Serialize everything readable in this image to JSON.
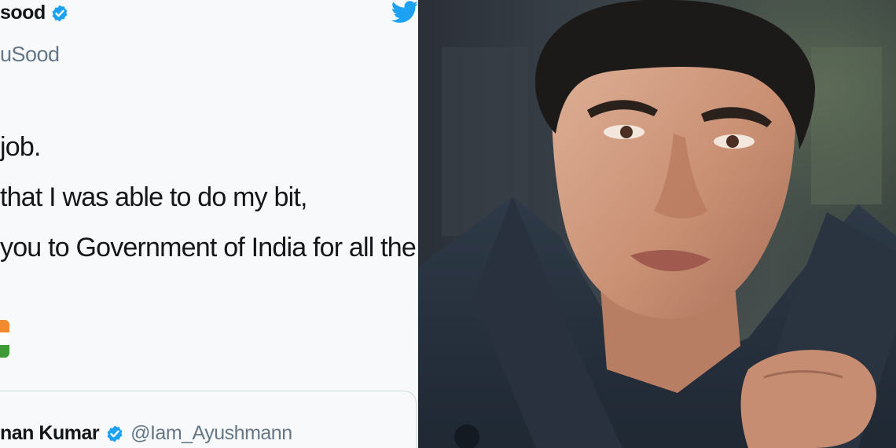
{
  "tweet": {
    "author_name": "sood",
    "author_handle": "uSood",
    "lines": [
      "job.",
      "that I was able to do my bit,",
      "you to Government of India for all the"
    ],
    "quoted": {
      "author_name": "nan Kumar",
      "author_handle": "@Iam_Ayushmann"
    }
  },
  "icons": {
    "verified": "verified-badge-icon",
    "twitter": "twitter-bird-icon",
    "flag": "india-flag-emoji"
  },
  "colors": {
    "twitter_blue": "#1da1f2",
    "text": "#14171a",
    "muted": "#657786",
    "panel_bg": "#f7f9fa"
  }
}
